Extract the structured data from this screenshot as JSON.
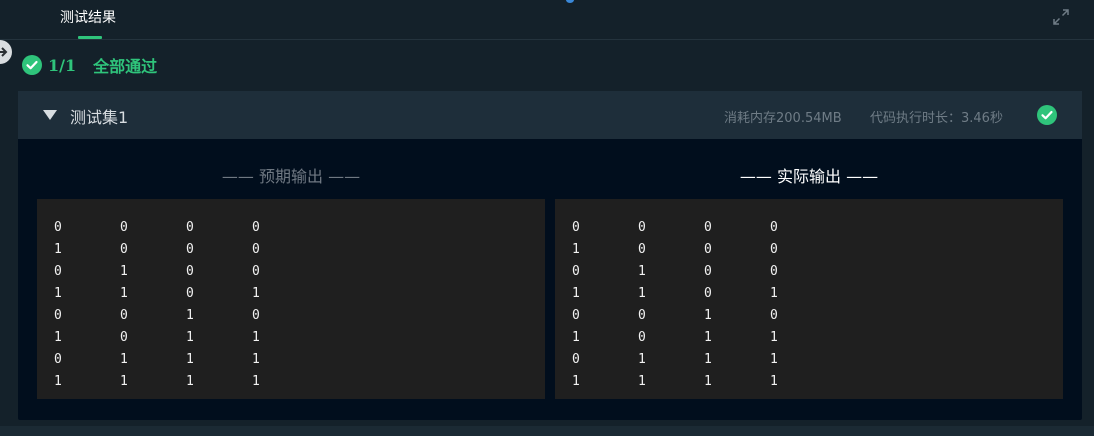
{
  "tab": {
    "label": "测试结果"
  },
  "summary": {
    "count": "1/1",
    "status": "全部通过"
  },
  "testset": {
    "name": "测试集1",
    "memory": "消耗内存200.54MB",
    "time": "代码执行时长：3.46秒"
  },
  "expected": {
    "title": "—— 预期输出 ——",
    "rows": [
      [
        "0",
        "0",
        "0",
        "0"
      ],
      [
        "1",
        "0",
        "0",
        "0"
      ],
      [
        "0",
        "1",
        "0",
        "0"
      ],
      [
        "1",
        "1",
        "0",
        "1"
      ],
      [
        "0",
        "0",
        "1",
        "0"
      ],
      [
        "1",
        "0",
        "1",
        "1"
      ],
      [
        "0",
        "1",
        "1",
        "1"
      ],
      [
        "1",
        "1",
        "1",
        "1"
      ]
    ]
  },
  "actual": {
    "title": "—— 实际输出 ——",
    "rows": [
      [
        "0",
        "0",
        "0",
        "0"
      ],
      [
        "1",
        "0",
        "0",
        "0"
      ],
      [
        "0",
        "1",
        "0",
        "0"
      ],
      [
        "1",
        "1",
        "0",
        "1"
      ],
      [
        "0",
        "0",
        "1",
        "0"
      ],
      [
        "1",
        "0",
        "1",
        "1"
      ],
      [
        "0",
        "1",
        "1",
        "1"
      ],
      [
        "1",
        "1",
        "1",
        "1"
      ]
    ]
  },
  "colors": {
    "accent": "#2fc47b",
    "background": "#14212a",
    "card": "#010e1d",
    "output_box": "#1f1f1f"
  },
  "icons": {
    "expand": "expand-icon",
    "summary_check": "check-circle-icon",
    "caret": "caret-down-icon",
    "pass": "check-circle-icon",
    "side_handle": "arrow-right-icon"
  }
}
